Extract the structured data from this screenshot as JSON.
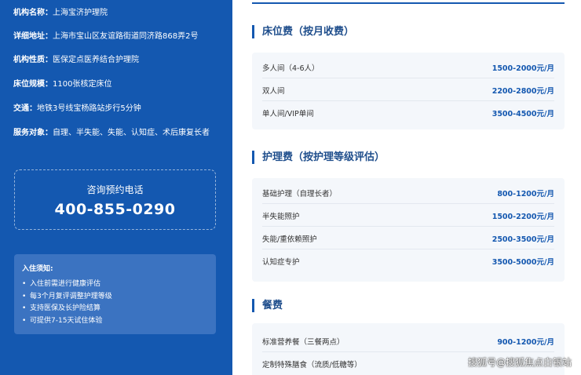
{
  "info": [
    {
      "label": "机构名称：",
      "value": "上海宝济护理院"
    },
    {
      "label": "详细地址：",
      "value": "上海市宝山区友谊路街道同济路868弄2号"
    },
    {
      "label": "机构性质：",
      "value": "医保定点医养结合护理院"
    },
    {
      "label": "床位规模：",
      "value": "1100张核定床位"
    },
    {
      "label": "交通：",
      "value": "地铁3号线宝杨路站步行5分钟"
    },
    {
      "label": "服务对象：",
      "value": "自理、半失能、失能、认知症、术后康复长者"
    }
  ],
  "contact": {
    "label": "咨询预约电话",
    "phone": "400-855-0290"
  },
  "notice": {
    "title": "入住须知:",
    "items": [
      "入住前需进行健康评估",
      "每3个月复评调整护理等级",
      "支持医保及长护险结算",
      "可提供7-15天试住体验"
    ]
  },
  "sections": [
    {
      "title": "床位费（按月收费）",
      "rows": [
        {
          "name": "多人间（4-6人）",
          "price": "1500-2000元/月"
        },
        {
          "name": "双人间",
          "price": "2200-2800元/月"
        },
        {
          "name": "单人间/VIP单间",
          "price": "3500-4500元/月"
        }
      ]
    },
    {
      "title": "护理费（按护理等级评估）",
      "rows": [
        {
          "name": "基础护理（自理长者）",
          "price": "800-1200元/月"
        },
        {
          "name": "半失能照护",
          "price": "1500-2200元/月"
        },
        {
          "name": "失能/重依赖照护",
          "price": "2500-3500元/月"
        },
        {
          "name": "认知症专护",
          "price": "3500-5000元/月"
        }
      ]
    },
    {
      "title": "餐费",
      "rows": [
        {
          "name": "标准营养餐（三餐两点）",
          "price": "900-1200元/月"
        },
        {
          "name": "定制特殊膳食（流质/低糖等）",
          "price": ""
        }
      ]
    }
  ],
  "watermark": "搜狐号@搜狐焦点白银站",
  "colors": {
    "primary": "#1458b0",
    "notice_bg": "#3b73c1",
    "card_bg": "#f4f7fb",
    "price": "#1458b0"
  }
}
